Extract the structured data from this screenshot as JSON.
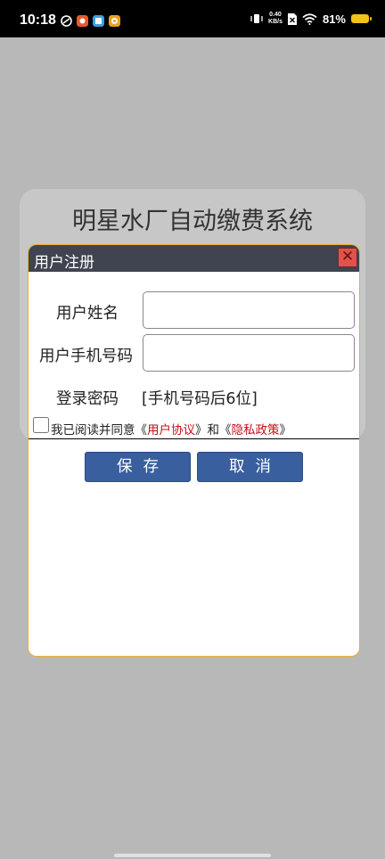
{
  "status_bar": {
    "time": "10:18",
    "net_speed_value": "0.40",
    "net_speed_unit": "KB/s",
    "battery_percent": "81%",
    "battery_color": "#f2c21b"
  },
  "background": {
    "title": "明星水厂自动缴费系统"
  },
  "dialog": {
    "title": "用户注册",
    "close_symbol": "✕",
    "fields": {
      "name_label": "用户姓名",
      "name_value": "",
      "phone_label": "用户手机号码",
      "phone_value": "",
      "password_label": "登录密码",
      "password_hint": "[手机号码后6位]"
    },
    "agreement": {
      "prefix": "我已阅读并同意《",
      "user_agreement": "用户协议",
      "middle": "》和《",
      "privacy_policy": "隐私政策",
      "suffix": "》",
      "checked": false
    },
    "buttons": {
      "save": "保存",
      "cancel": "取消"
    }
  },
  "colors": {
    "header": "#3f4450",
    "button": "#3a5f9f",
    "link": "#c0101a",
    "dialog_border": "#e9b031"
  }
}
